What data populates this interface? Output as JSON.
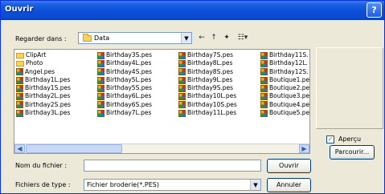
{
  "window": {
    "title": "Ouvrir",
    "help_icon": "question-mark",
    "help_label": "?"
  },
  "lookin": {
    "label": "Regarder dans :",
    "value": "Data"
  },
  "toolbar": {
    "back_icon": "back-arrow-icon",
    "back": "←",
    "up": "↑",
    "newfolder": "✦",
    "views": "☷▾"
  },
  "files": {
    "columns": [
      [
        {
          "name": "ClipArt",
          "type": "folder"
        },
        {
          "name": "Photo",
          "type": "folder"
        },
        {
          "name": "Angel.pes",
          "type": "pes"
        },
        {
          "name": "Birthday1L.pes",
          "type": "pes"
        },
        {
          "name": "Birthday1S.pes",
          "type": "pes"
        },
        {
          "name": "Birthday2L.pes",
          "type": "pes"
        },
        {
          "name": "Birthday2S.pes",
          "type": "pes"
        },
        {
          "name": "Birthday3L.pes",
          "type": "pes"
        }
      ],
      [
        {
          "name": "Birthday3S.pes",
          "type": "pes"
        },
        {
          "name": "Birthday4L.pes",
          "type": "pes"
        },
        {
          "name": "Birthday4S.pes",
          "type": "pes"
        },
        {
          "name": "Birthday5L.pes",
          "type": "pes"
        },
        {
          "name": "Birthday5S.pes",
          "type": "pes"
        },
        {
          "name": "Birthday6L.pes",
          "type": "pes"
        },
        {
          "name": "Birthday6S.pes",
          "type": "pes"
        },
        {
          "name": "Birthday7L.pes",
          "type": "pes"
        }
      ],
      [
        {
          "name": "Birthday7S.pes",
          "type": "pes"
        },
        {
          "name": "Birthday8L.pes",
          "type": "pes"
        },
        {
          "name": "Birthday8S.pes",
          "type": "pes"
        },
        {
          "name": "Birthday9L.pes",
          "type": "pes"
        },
        {
          "name": "Birthday9S.pes",
          "type": "pes"
        },
        {
          "name": "Birthday10L.pes",
          "type": "pes"
        },
        {
          "name": "Birthday10S.pes",
          "type": "pes"
        },
        {
          "name": "Birthday11L.pes",
          "type": "pes"
        }
      ],
      [
        {
          "name": "Birthday11S.",
          "type": "pes"
        },
        {
          "name": "Birthday12L.",
          "type": "pes"
        },
        {
          "name": "Birthday12S.",
          "type": "pes"
        },
        {
          "name": "Boutique1.pe",
          "type": "pes"
        },
        {
          "name": "Boutique2.pe",
          "type": "pes"
        },
        {
          "name": "Boutique3.pe",
          "type": "pes"
        },
        {
          "name": "Boutique4.pe",
          "type": "pes"
        },
        {
          "name": "Boutique5.pe",
          "type": "pes"
        }
      ]
    ]
  },
  "scrollbar": {
    "left": "◀",
    "right": "▶"
  },
  "preview": {
    "checkbox_label": "Aperçu",
    "checked": true,
    "check_mark": "✓",
    "browse_label": "Parcourir..."
  },
  "filename": {
    "label": "Nom du fichier :",
    "value": ""
  },
  "filetype": {
    "label": "Fichiers de type :",
    "value": "Fichier broderie(*.PES)"
  },
  "buttons": {
    "open": "Ouvrir",
    "cancel": "Annuler"
  }
}
